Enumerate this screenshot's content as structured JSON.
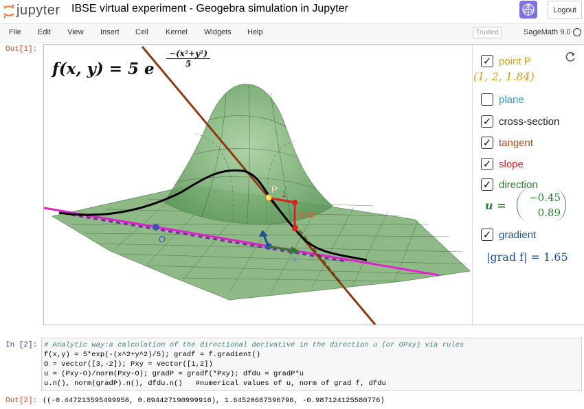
{
  "header": {
    "logo_text": "jupyter",
    "notebook_title": "IBSE virtual experiment - Geogebra simulation in Jupyter",
    "logout_label": "Logout"
  },
  "menu": {
    "items": [
      "File",
      "Edit",
      "View",
      "Insert",
      "Cell",
      "Kernel",
      "Widgets",
      "Help"
    ],
    "trusted_label": "Trusted",
    "kernel_name": "SageMath 9.0"
  },
  "cells": {
    "out1_prompt": "Out[1]:",
    "in2_prompt": "In [2]:",
    "out2_prompt": "Out[2]:"
  },
  "applet": {
    "formula_prefix": "f(x, y) = 5 e",
    "formula_exponent": "−(x²+y²)",
    "formula_denominator": "5",
    "point_label": "P",
    "slope_value": "0.98",
    "origin_label": "O",
    "u_label": "u",
    "v_label": "v",
    "checkboxes": [
      {
        "label": "point P",
        "checked": true,
        "color": "#d9a017"
      },
      {
        "label": "plane",
        "checked": false,
        "color": "#2a9ad6"
      },
      {
        "label": "cross-section",
        "checked": true,
        "color": "#222222"
      },
      {
        "label": "tangent",
        "checked": true,
        "color": "#b0471d"
      },
      {
        "label": "slope",
        "checked": true,
        "color": "#e02020"
      },
      {
        "label": "direction",
        "checked": true,
        "color": "#2e7d32"
      },
      {
        "label": "gradient",
        "checked": true,
        "color": "#1f4f8f"
      }
    ],
    "point_coords": "(1, 2, 1.84)",
    "u_vector_lhs": "u =",
    "u_vector_top": "−0.45",
    "u_vector_bottom": "0.89",
    "grad_norm": "|grad f| = 1.65"
  },
  "code": {
    "lines": [
      "# Analytic way:a calculation of the directional derivative in the direction u (or OPxy) via rules",
      "f(x,y) = 5*exp(-(x^2+y^2)/5); gradf = f.gradient()",
      "O = vector([3,-2]); Pxy = vector([1,2])",
      "u = (Pxy-O)/norm(Pxy-O); gradP = gradf(*Pxy); dfdu = gradP*u",
      "u.n(), norm(gradP).n(), dfdu.n()   #numerical values of u, norm of grad f, dfdu"
    ]
  },
  "output2": "((-0.447213595499958, 0.894427190999916), 1.64520687596796, -0.987124125580776)"
}
